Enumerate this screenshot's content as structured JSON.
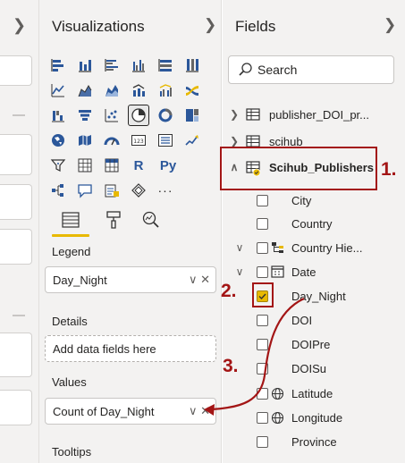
{
  "left_pane": {
    "collapse_icon": "chevron-right-icon"
  },
  "visualizations": {
    "title": "Visualizations",
    "collapse_icon": "chevron-right-icon",
    "visual_icons": [
      "stacked-bar-chart-icon",
      "stacked-column-chart-icon",
      "clustered-bar-chart-icon",
      "clustered-column-chart-icon",
      "100-stacked-bar-chart-icon",
      "100-stacked-column-chart-icon",
      "line-chart-icon",
      "area-chart-icon",
      "stacked-area-chart-icon",
      "line-and-column-chart-icon",
      "line-and-clustered-column-chart-icon",
      "ribbon-chart-icon",
      "waterfall-chart-icon",
      "funnel-chart-icon",
      "scatter-chart-icon",
      "pie-chart-icon",
      "donut-chart-icon",
      "treemap-icon",
      "map-icon",
      "filled-map-icon",
      "gauge-icon",
      "card-icon",
      "multi-row-card-icon",
      "kpi-icon",
      "slicer-icon",
      "table-icon",
      "matrix-icon",
      "r-visual-icon",
      "python-visual-icon",
      "",
      "decomposition-tree-icon",
      "qa-icon",
      "smart-narrative-icon",
      "paginated-report-icon",
      "more-visuals-icon",
      ""
    ],
    "r_label": "R",
    "py_label": "Py",
    "more_label": "···",
    "selected_icon": "pie-chart-icon",
    "build_tabs": [
      "fields-tab-icon",
      "format-paintbrush-icon",
      "analytics-magnifier-icon"
    ],
    "legend": {
      "label": "Legend",
      "value": "Day_Night",
      "controls": "∨ ✕"
    },
    "details": {
      "label": "Details",
      "placeholder": "Add data fields here"
    },
    "values": {
      "label": "Values",
      "value": "Count of Day_Night",
      "controls": "∨ ✕"
    },
    "tooltips": {
      "label": "Tooltips"
    }
  },
  "fields": {
    "title": "Fields",
    "collapse_icon": "chevron-right-icon",
    "search_placeholder": "Search",
    "tables": [
      {
        "name": "publisher_DOI_pr...",
        "expanded": false
      },
      {
        "name": "scihub",
        "expanded": false
      },
      {
        "name": "Scihub_Publishers",
        "expanded": true
      }
    ],
    "columns": [
      {
        "name": "City",
        "checked": false,
        "icon": "",
        "expander": false
      },
      {
        "name": "Country",
        "checked": false,
        "icon": "",
        "expander": false
      },
      {
        "name": "Country Hie...",
        "checked": false,
        "icon": "hierarchy-icon",
        "expander": true
      },
      {
        "name": "Date",
        "checked": false,
        "icon": "calendar-icon",
        "expander": true
      },
      {
        "name": "Day_Night",
        "checked": true,
        "icon": "",
        "expander": false
      },
      {
        "name": "DOI",
        "checked": false,
        "icon": "",
        "expander": false
      },
      {
        "name": "DOIPre",
        "checked": false,
        "icon": "",
        "expander": false
      },
      {
        "name": "DOISu",
        "checked": false,
        "icon": "",
        "expander": false
      },
      {
        "name": "Latitude",
        "checked": false,
        "icon": "globe-icon",
        "expander": false
      },
      {
        "name": "Longitude",
        "checked": false,
        "icon": "globe-icon",
        "expander": false
      },
      {
        "name": "Province",
        "checked": false,
        "icon": "",
        "expander": false
      }
    ]
  },
  "annotations": {
    "step1": "1.",
    "step2": "2.",
    "step3": "3.",
    "color": "#a31515"
  },
  "colors": {
    "accent": "#e8b900",
    "annotation": "#a31515"
  }
}
